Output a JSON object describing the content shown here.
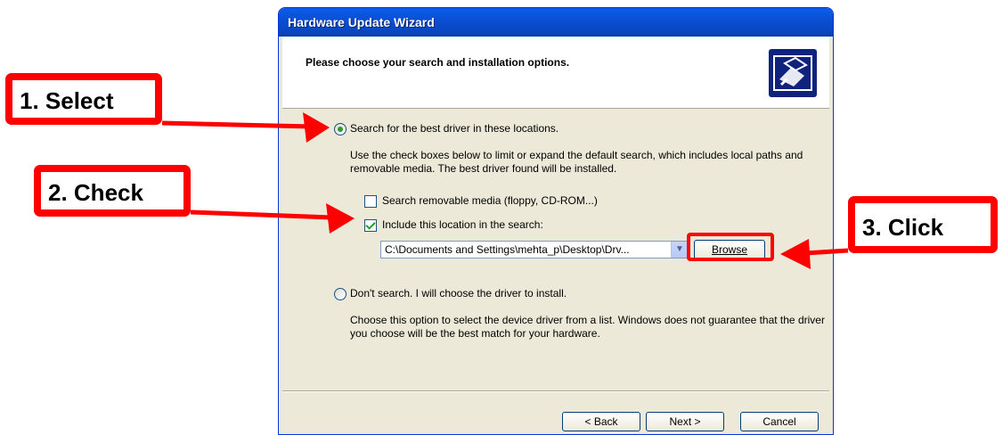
{
  "window": {
    "title": "Hardware Update Wizard",
    "header_title": "Please choose your search and installation options.",
    "header_icon": "hardware-wizard-icon"
  },
  "options": {
    "search_label": "Search for the best driver in these locations.",
    "search_desc": "Use the check boxes below to limit or expand the default search, which includes local paths and removable media. The best driver found will be installed.",
    "removable_label": "Search removable media (floppy, CD-ROM...)",
    "include_label": "Include this location in the search:",
    "location_value": "C:\\Documents and Settings\\mehta_p\\Desktop\\Drv...",
    "browse_label": "Browse",
    "dont_search_label": "Don't search. I will choose the driver to install.",
    "dont_search_desc": "Choose this option to select the device driver from a list.  Windows does not guarantee that the driver you choose will be the best match for your hardware."
  },
  "footer": {
    "back_label": "< Back",
    "next_label": "Next >",
    "cancel_label": "Cancel"
  },
  "annotations": {
    "step1": "1. Select",
    "step2": "2. Check",
    "step3": "3. Click",
    "color": "#ff0000"
  }
}
